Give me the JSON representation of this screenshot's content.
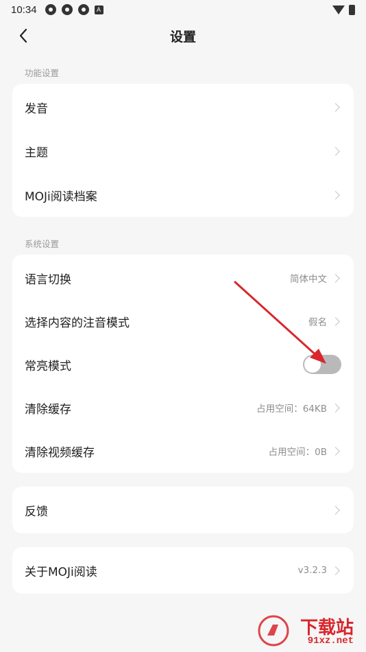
{
  "status_bar": {
    "time": "10:34",
    "app_letter": "A"
  },
  "header": {
    "title": "设置"
  },
  "sections": {
    "function": {
      "label": "功能设置",
      "items": [
        "发音",
        "主题",
        "MOJi阅读档案"
      ]
    },
    "system": {
      "label": "系统设置",
      "items": [
        {
          "label": "语言切换",
          "value": "简体中文"
        },
        {
          "label": "选择内容的注音模式",
          "value": "假名"
        },
        {
          "label": "常亮模式",
          "toggle_on": false
        },
        {
          "label": "清除缓存",
          "value": "占用空间：64KB"
        },
        {
          "label": "清除视频缓存",
          "value": "占用空间：0B"
        }
      ]
    },
    "feedback": {
      "label": "反馈"
    },
    "about": {
      "label": "关于MOJi阅读",
      "value": "v3.2.3"
    }
  },
  "watermark": {
    "brand": "下载站",
    "domain": "91xz.net"
  },
  "colors": {
    "background": "#f6f6f6",
    "card": "#ffffff",
    "toggle_off": "#b9b9b9",
    "annotation_arrow": "#d8262c"
  }
}
